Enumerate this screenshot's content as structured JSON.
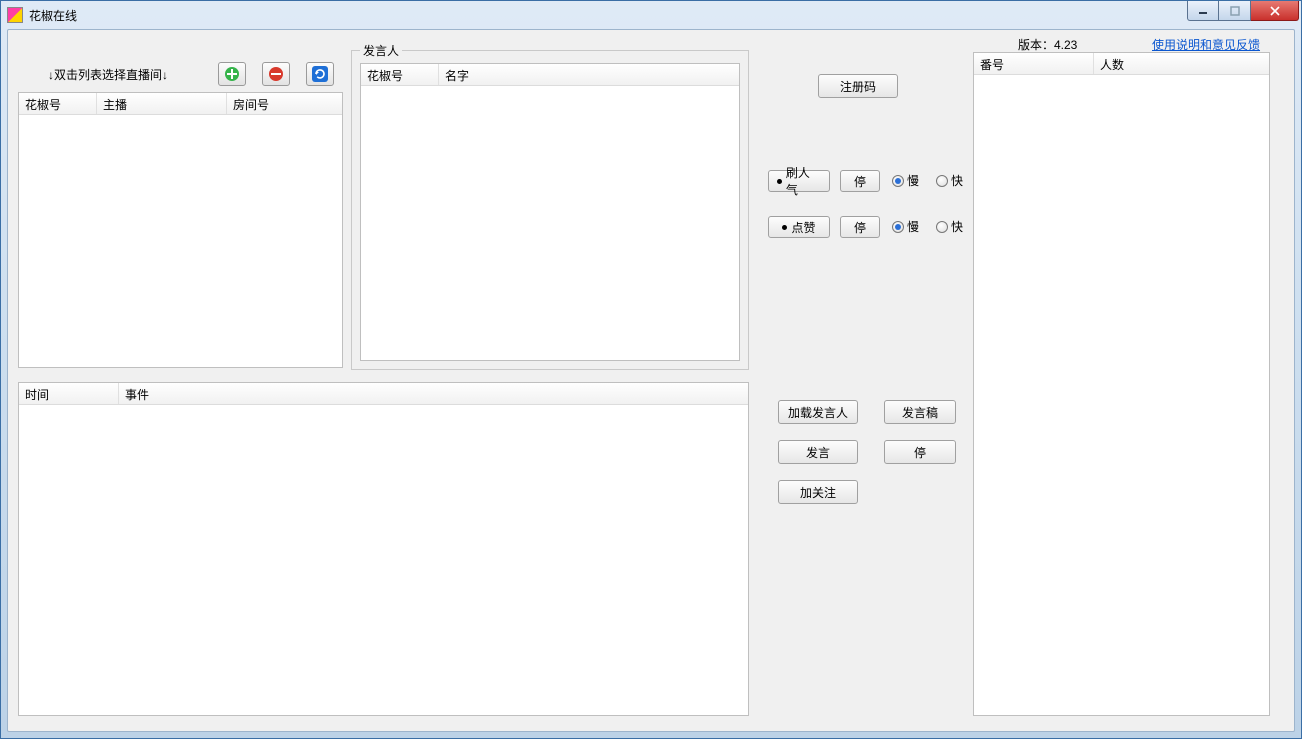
{
  "window": {
    "title": "花椒在线"
  },
  "top": {
    "instruction": "↓双击列表选择直播间↓",
    "version_label": "版本：4.23",
    "help_link": "使用说明和意见反馈"
  },
  "icons": {
    "add": "add-icon",
    "remove": "remove-icon",
    "refresh": "refresh-icon"
  },
  "broadcast_table": {
    "columns": [
      "花椒号",
      "主播",
      "房间号"
    ]
  },
  "speaker_panel": {
    "legend": "发言人",
    "columns": [
      "花椒号",
      "名字"
    ]
  },
  "events_table": {
    "columns": [
      "时间",
      "事件"
    ]
  },
  "right_table": {
    "columns": [
      "番号",
      "人数"
    ]
  },
  "controls": {
    "register": "注册码",
    "popularity": {
      "label": "刷人气",
      "stop": "停",
      "slow": "慢",
      "fast": "快",
      "speed_selected": "slow"
    },
    "like": {
      "label": "点赞",
      "stop": "停",
      "slow": "慢",
      "fast": "快",
      "speed_selected": "slow"
    },
    "load_speakers": "加载发言人",
    "speech_script": "发言稿",
    "speak": "发言",
    "stop": "停",
    "follow": "加关注"
  }
}
